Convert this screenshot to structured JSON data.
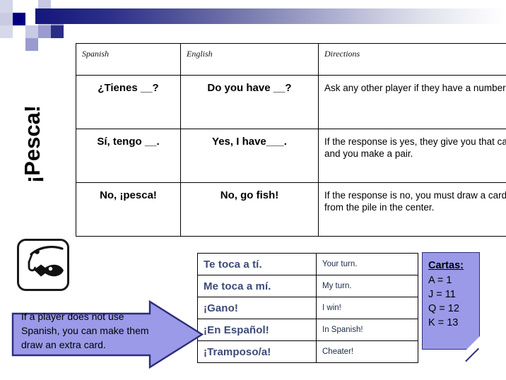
{
  "slide": {
    "title": "¡Pesca!",
    "header_accent_dark": "#14177c",
    "header_accent_light": "#9a9ae8"
  },
  "main_table": {
    "headers": [
      "Spanish",
      "English",
      "Directions"
    ],
    "rows": [
      {
        "spanish": "¿Tienes __?",
        "english": "Do you have __?",
        "directions": "Ask any other player if they have a number."
      },
      {
        "spanish": "Sí, tengo __.",
        "english": "Yes, I have___.",
        "directions": "If the response is yes, they give you that card and you make a pair."
      },
      {
        "spanish": "No, ¡pesca!",
        "english": "No, go fish!",
        "directions": "If the response is no, you must draw a card from the pile in the center."
      }
    ]
  },
  "phrases_table": {
    "rows": [
      {
        "spanish": "Te toca a tí.",
        "english": "Your turn."
      },
      {
        "spanish": "Me toca a mí.",
        "english": "My turn."
      },
      {
        "spanish": "¡Gano!",
        "english": "I win!"
      },
      {
        "spanish": "¡En Español!",
        "english": "In Spanish!"
      },
      {
        "spanish": "¡Tramposo/a!",
        "english": "Cheater!"
      }
    ]
  },
  "cartas_note": {
    "title": "Cartas:",
    "lines": [
      "A = 1",
      "J = 11",
      "Q = 12",
      "K = 13"
    ],
    "fill_color": "#9a9ae8",
    "border_color": "#2c2c7a"
  },
  "arrow_callout": {
    "text": "If a player does not use Spanish, you can make them draw an extra card.",
    "fill_color": "#9a9ae8",
    "border_color": "#2c2c7a"
  },
  "icons": {
    "fishing": "fishing-hook-and-fish-icon"
  }
}
